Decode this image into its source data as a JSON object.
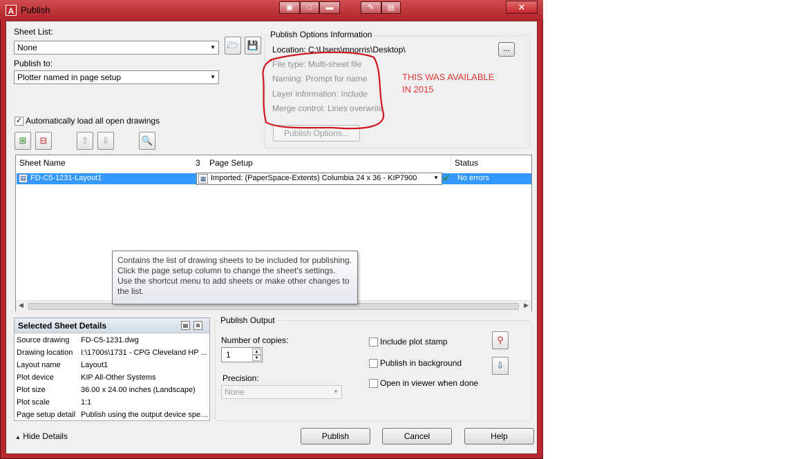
{
  "window": {
    "title": "Publish",
    "app_icon": "autocad-icon",
    "close_label": "✕"
  },
  "sheet_list": {
    "label": "Sheet List:",
    "value": "None"
  },
  "publish_to": {
    "label": "Publish to:",
    "value": "Plotter named in page setup"
  },
  "auto_load": {
    "label": "Automatically load all open drawings",
    "checked": true
  },
  "publish_options": {
    "title": "Publish Options Information",
    "location_label": "Location:",
    "location_value": "C:\\Users\\mnorris\\Desktop\\",
    "browse_label": "...",
    "file_type": "File type: Multi-sheet file",
    "naming": "Naming: Prompt for name",
    "layer_info": "Layer information: Include",
    "merge_control": "Merge control: Lines overwrite",
    "button_label": "Publish Options..."
  },
  "annotation": {
    "line1": "THIS WAS AVAILABLE",
    "line2": "IN 2015",
    "color": "#e03535"
  },
  "table": {
    "columns": [
      "Sheet Name",
      "3",
      "Page Setup",
      "Status"
    ],
    "rows": [
      {
        "sheet_name": "FD-C5-1231-Layout1",
        "page_setup": "Imported: (PaperSpace-Extents) Columbia 24 x 36 - KIP7900",
        "status": "No errors"
      }
    ]
  },
  "tooltip": {
    "text": "Contains the list of drawing sheets to be included for publishing. Click the page setup column to change the sheet's settings. Use the shortcut menu to add sheets or make other changes to the list."
  },
  "details": {
    "title": "Selected Sheet Details",
    "rows": [
      {
        "key": "Source drawing",
        "value": "FD-C5-1231.dwg"
      },
      {
        "key": "Drawing location",
        "value": "I:\\1700s\\1731 - CPG Cleveland HP ..."
      },
      {
        "key": "Layout name",
        "value": "Layout1"
      },
      {
        "key": "Plot device",
        "value": "KIP All-Other Systems"
      },
      {
        "key": "Plot size",
        "value": "36.00 x 24.00 inches (Landscape)"
      },
      {
        "key": "Plot scale",
        "value": "1:1"
      },
      {
        "key": "Page setup detail",
        "value": "Publish using the output device spec..."
      }
    ]
  },
  "publish_output": {
    "title": "Publish Output",
    "copies_label": "Number of copies:",
    "copies_value": "1",
    "precision_label": "Precision:",
    "precision_value": "None",
    "include_stamp": "Include plot stamp",
    "publish_background": "Publish in background",
    "open_viewer": "Open in viewer when done"
  },
  "footer": {
    "hide_details": "Hide Details",
    "publish": "Publish",
    "cancel": "Cancel",
    "help": "Help"
  }
}
